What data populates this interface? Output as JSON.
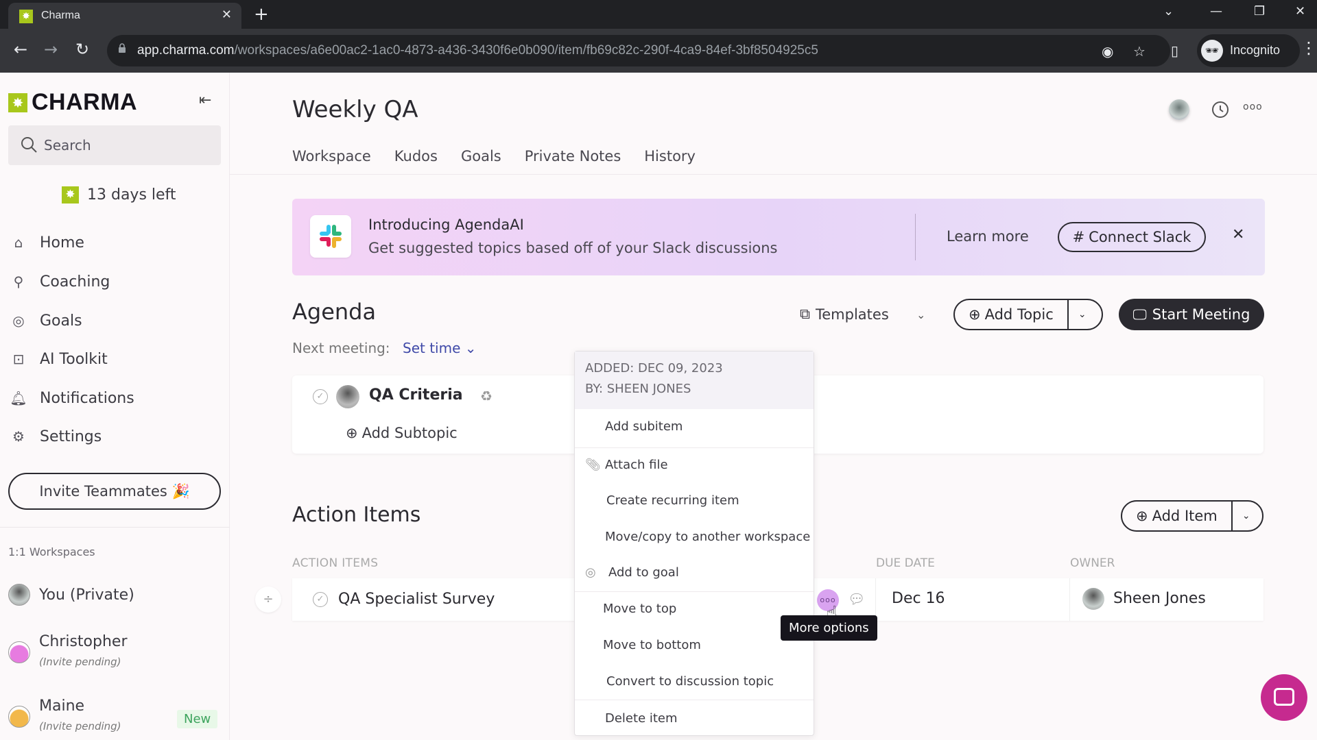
{
  "browser": {
    "tab_title": "Charma",
    "url_host": "app.charma.com",
    "url_path": "/workspaces/a6e00ac2-1ac0-4873-a436-3430f6e0b090/item/fb69c82c-290f-4ca9-84ef-3bf8504925c5",
    "profile_label": "Incognito"
  },
  "sidebar": {
    "logo_text": "CHARMA",
    "search_placeholder": "Search",
    "trial_text": "13 days left",
    "nav": [
      {
        "label": "Home",
        "icon": "home-icon"
      },
      {
        "label": "Coaching",
        "icon": "whistle-icon"
      },
      {
        "label": "Goals",
        "icon": "target-icon"
      },
      {
        "label": "AI Toolkit",
        "icon": "robot-icon"
      },
      {
        "label": "Notifications",
        "icon": "bell-icon"
      },
      {
        "label": "Settings",
        "icon": "gear-icon"
      }
    ],
    "invite_label": "Invite Teammates 🎉",
    "workspaces_title": "1:1 Workspaces",
    "workspaces": [
      {
        "name": "You (Private)",
        "sub": "",
        "badge": ""
      },
      {
        "name": "Christopher",
        "sub": "(Invite pending)",
        "badge": ""
      },
      {
        "name": "Maine",
        "sub": "(Invite pending)",
        "badge": "New"
      }
    ]
  },
  "header": {
    "title": "Weekly QA",
    "tabs": [
      "Workspace",
      "Kudos",
      "Goals",
      "Private Notes",
      "History"
    ]
  },
  "banner": {
    "heading": "Introducing AgendaAI",
    "subtext": "Get suggested topics based off of your Slack discussions",
    "learn_more": "Learn more",
    "connect_label": "Connect Slack"
  },
  "agenda": {
    "title": "Agenda",
    "next_meeting_label": "Next meeting:",
    "set_time_label": "Set time",
    "templates_label": "Templates",
    "add_topic_label": "Add Topic",
    "start_meeting_label": "Start Meeting",
    "topics": [
      {
        "title": "QA Criteria"
      }
    ],
    "add_subtopic_label": "Add Subtopic"
  },
  "action_items": {
    "title": "Action Items",
    "add_item_label": "Add Item",
    "columns": [
      "ACTION ITEMS",
      "DUE DATE",
      "OWNER"
    ],
    "rows": [
      {
        "title": "QA Specialist Survey",
        "due": "Dec 16",
        "owner": "Sheen Jones"
      }
    ]
  },
  "context_menu": {
    "added": "ADDED: DEC 09, 2023",
    "by": "BY: SHEEN JONES",
    "items": [
      {
        "label": "Add subitem",
        "icon": ""
      },
      {
        "label": "Attach file",
        "icon": "paperclip-icon"
      },
      {
        "label": "Create recurring item",
        "icon": ""
      },
      {
        "label": "Move/copy to another workspace",
        "icon": ""
      },
      {
        "label": "Add to goal",
        "icon": "target-icon"
      },
      {
        "label": "Move to top",
        "icon": ""
      },
      {
        "label": "Move to bottom",
        "icon": ""
      },
      {
        "label": "Convert to discussion topic",
        "icon": ""
      },
      {
        "label": "Delete item",
        "icon": ""
      }
    ]
  },
  "tooltip": "More options",
  "colors": {
    "brand_green": "#a8c71c",
    "accent_blue": "#3f49a8",
    "more_button": "#d9a3f0",
    "chat_fab": "#c62a8f",
    "new_badge": "#3da35d"
  }
}
